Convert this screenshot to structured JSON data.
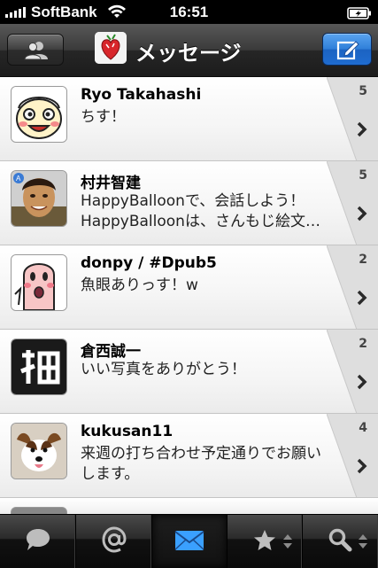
{
  "status_bar": {
    "carrier": "SoftBank",
    "time": "16:51"
  },
  "nav": {
    "title": "メッセージ",
    "left_button_icon": "contacts-icon",
    "right_button_icon": "compose-icon"
  },
  "messages": [
    {
      "name": "Ryo Takahashi",
      "lines": [
        "ちす！"
      ],
      "count": "5",
      "avatar": "cartoon-face-avatar"
    },
    {
      "name": "村井智建",
      "lines": [
        "HappyBalloonで、会話しよう！",
        "HappyBalloonは、さんもじ絵文…"
      ],
      "count": "5",
      "avatar": "man-photo-avatar"
    },
    {
      "name": "donpy / #Dpub5",
      "lines": [
        "魚眼ありっす！w"
      ],
      "count": "2",
      "avatar": "pink-character-avatar"
    },
    {
      "name": "倉西誠一",
      "lines": [
        "いい写真をありがとう！"
      ],
      "count": "2",
      "avatar": "kanji-logo-avatar"
    },
    {
      "name": "kukusan11",
      "lines": [
        "来週の打ち合わせ予定通りでお願い",
        "します。"
      ],
      "count": "4",
      "avatar": "dog-photo-avatar"
    }
  ],
  "tabs": [
    {
      "icon": "speech-bubble-icon",
      "active": false
    },
    {
      "icon": "at-sign-icon",
      "active": false
    },
    {
      "icon": "envelope-icon",
      "active": true
    },
    {
      "icon": "star-icon",
      "active": false
    },
    {
      "icon": "search-icon",
      "active": false
    }
  ],
  "colors": {
    "compose_button": "#2f7fd9",
    "active_tab_icon": "#3aa0ff"
  }
}
